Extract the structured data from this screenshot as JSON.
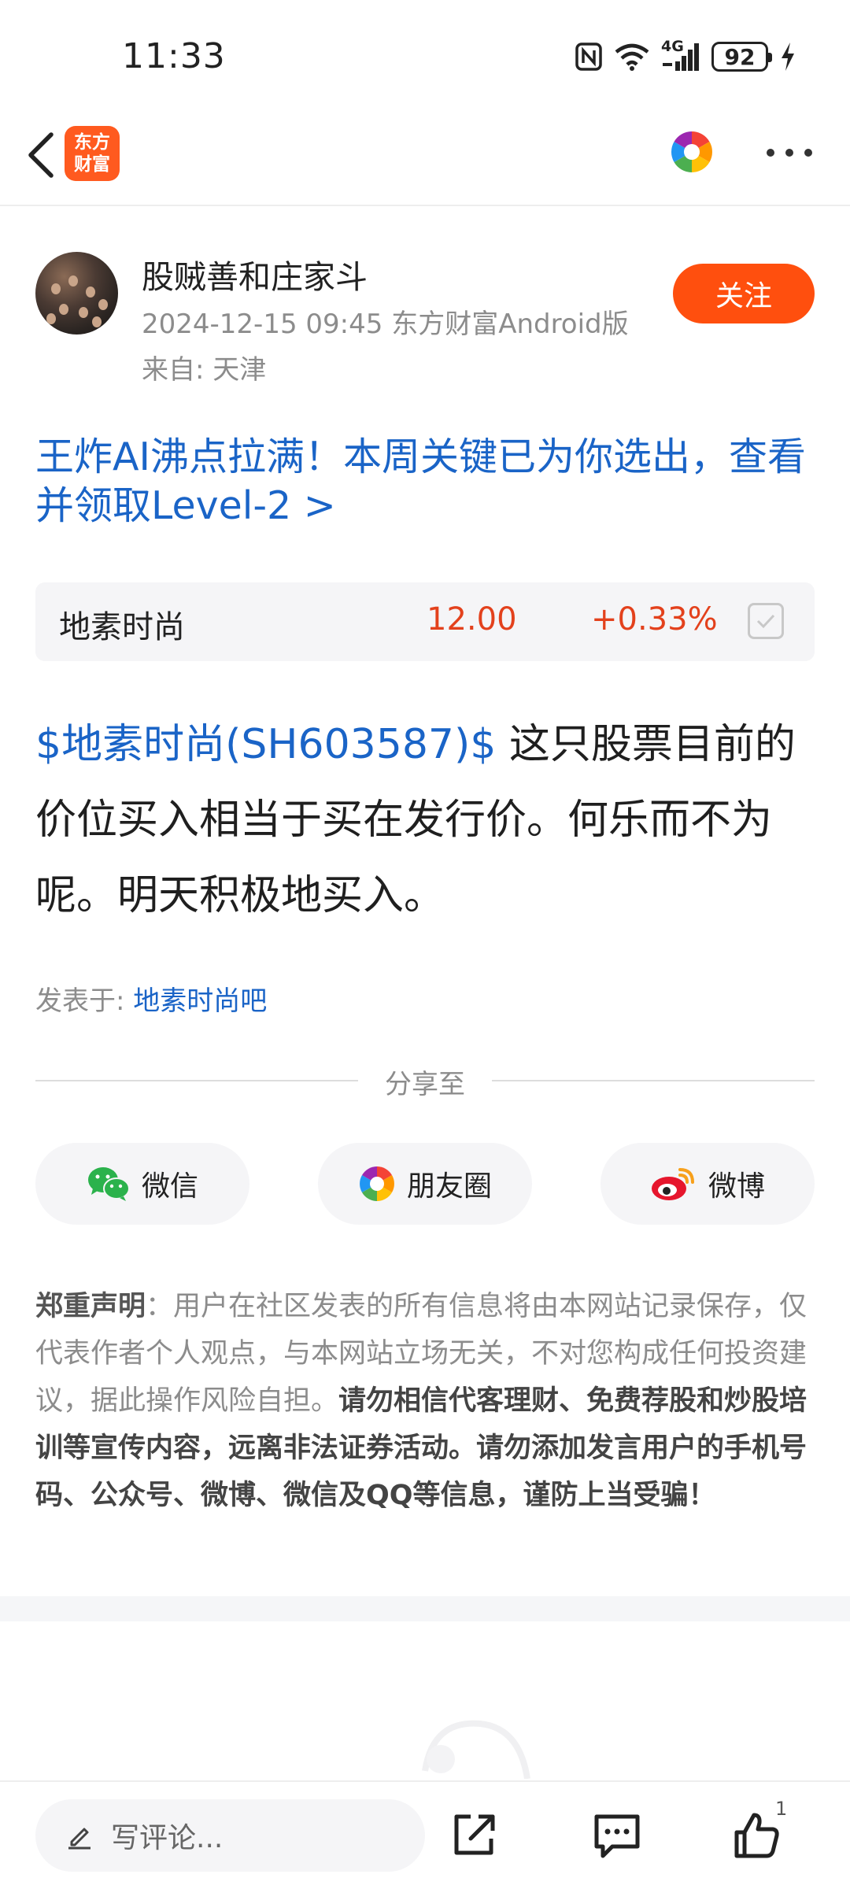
{
  "status_bar": {
    "time": "11:33",
    "battery": "92",
    "network": "4G",
    "icons": [
      "nfc-icon",
      "wifi-icon",
      "signal-icon",
      "battery-icon",
      "charging-icon"
    ]
  },
  "nav": {
    "logo_line1": "东方",
    "logo_line2": "财富",
    "icons": [
      "back-arrow-icon",
      "pinwheel-icon",
      "more-dots-icon"
    ]
  },
  "author": {
    "name": "股贼善和庄家斗",
    "meta": "2024-12-15 09:45 东方财富Android版",
    "location": "来自: 天津",
    "follow_label": "关注"
  },
  "promo": {
    "text": "王炸AI沸点拉满！本周关键已为你选出，查看并领取Level-2 >"
  },
  "stock": {
    "name": "地素时尚",
    "price": "12.00",
    "change": "+0.33%"
  },
  "post": {
    "mention": "$地素时尚(SH603587)$",
    "text": " 这只股票目前的价位买入相当于买在发行价。何乐而不为呢。明天积极地买入。",
    "posted_in_label": "发表于: ",
    "posted_in_bar": "地素时尚吧"
  },
  "share": {
    "title": "分享至",
    "buttons": [
      {
        "label": "微信",
        "icon": "wechat-icon"
      },
      {
        "label": "朋友圈",
        "icon": "moments-icon"
      },
      {
        "label": "微博",
        "icon": "weibo-icon"
      }
    ]
  },
  "disclaimer": {
    "lead": "郑重声明",
    "colon": "：",
    "normal": "用户在社区发表的所有信息将由本网站记录保存，仅代表作者个人观点，与本网站立场无关，不对您构成任何投资建议，据此操作风险自担。",
    "strong": "请勿相信代客理财、免费荐股和炒股培训等宣传内容，远离非法证券活动。请勿添加发言用户的手机号码、公众号、微博、微信及QQ等信息，谨防上当受骗！"
  },
  "bottom_bar": {
    "comment_placeholder": "写评论...",
    "like_count": "1",
    "icons": [
      "pencil-icon",
      "share-icon",
      "comment-icon",
      "thumbs-up-icon"
    ]
  },
  "colors": {
    "accent_orange": "#ff4f0e",
    "link_blue": "#1a64c7",
    "price_red": "#e3411c"
  }
}
